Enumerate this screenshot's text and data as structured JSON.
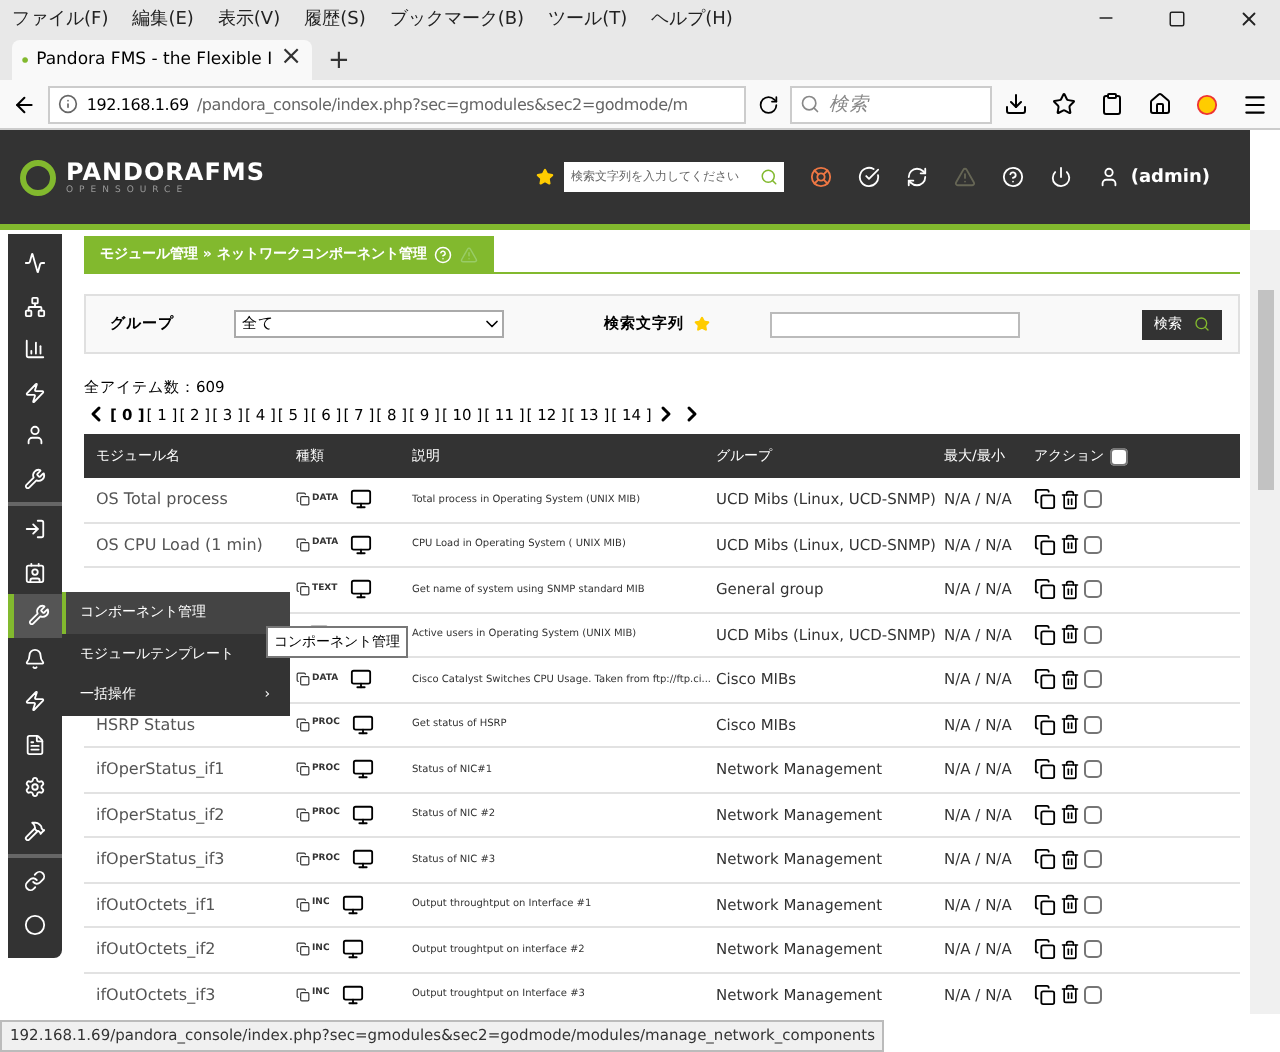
{
  "menubar": [
    "ファイル(F)",
    "編集(E)",
    "表示(V)",
    "履歴(S)",
    "ブックマーク(B)",
    "ツール(T)",
    "ヘルプ(H)"
  ],
  "tab": {
    "title": "Pandora FMS - the Flexible I",
    "close": "×",
    "new": "+"
  },
  "address": {
    "host": "192.168.1.69",
    "path": "/pandora_console/index.php?sec=gmodules&sec2=godmode/m",
    "search_placeholder": "検索"
  },
  "header": {
    "logo": "PANDORAFMS",
    "logo_sub": "OPENSOURCE",
    "search_placeholder": "検索文字列を入力してください",
    "user": "(admin)"
  },
  "breadcrumb": "モジュール管理 » ネットワークコンポーネント管理",
  "filter": {
    "group_label": "グループ",
    "group_value": "全て",
    "search_label": "検索文字列",
    "button": "検索"
  },
  "total": "全アイテム数：609",
  "pages": [
    {
      "label": "[ 0 ]",
      "selected": true
    },
    {
      "label": "[ 1 ]",
      "selected": false
    },
    {
      "label": "[ 2 ]",
      "selected": false
    },
    {
      "label": "[ 3 ]",
      "selected": false
    },
    {
      "label": "[ 4 ]",
      "selected": false
    },
    {
      "label": "[ 5 ]",
      "selected": false
    },
    {
      "label": "[ 6 ]",
      "selected": false
    },
    {
      "label": "[ 7 ]",
      "selected": false
    },
    {
      "label": "[ 8 ]",
      "selected": false
    },
    {
      "label": "[ 9 ]",
      "selected": false
    },
    {
      "label": "[ 10 ]",
      "selected": false
    },
    {
      "label": "[ 11 ]",
      "selected": false
    },
    {
      "label": "[ 12 ]",
      "selected": false
    },
    {
      "label": "[ 13 ]",
      "selected": false
    },
    {
      "label": "[ 14 ]",
      "selected": false
    }
  ],
  "columns": [
    "モジュール名",
    "種類",
    "説明",
    "グループ",
    "最大/最小",
    "アクション"
  ],
  "select_all_checked": false,
  "rows": [
    {
      "name": "OS Total process",
      "type": "DATA",
      "description": "Total process in Operating System (UNIX MIB)",
      "group": "UCD Mibs (Linux, UCD-SNMP)",
      "range": "N/A / N/A",
      "checked": false
    },
    {
      "name": "OS CPU Load (1 min)",
      "type": "DATA",
      "description": "CPU Load in Operating System ( UNIX MIB)",
      "group": "UCD Mibs (Linux, UCD-SNMP)",
      "range": "N/A / N/A",
      "checked": false
    },
    {
      "type": "TEXT",
      "description": "Get name of system using SNMP standard MIB",
      "group": "General group",
      "range": "N/A / N/A",
      "checked": false
    },
    {
      "description": "Active users in Operating System (UNIX MIB)",
      "group": "UCD Mibs (Linux, UCD-SNMP)",
      "range": "N/A / N/A",
      "checked": false
    },
    {
      "type": "DATA",
      "description": "Cisco Catalyst Switches CPU Usage. Taken from ftp://ftp.ci...",
      "group": "Cisco MIBs",
      "range": "N/A / N/A",
      "checked": false
    },
    {
      "name": "HSRP Status",
      "type": "PROC",
      "description": "Get status of HSRP",
      "group": "Cisco MIBs",
      "range": "N/A / N/A",
      "checked": false
    },
    {
      "name": "ifOperStatus_if1",
      "type": "PROC",
      "description": "Status of NIC#1",
      "group": "Network Management",
      "range": "N/A / N/A",
      "checked": false
    },
    {
      "name": "ifOperStatus_if2",
      "type": "PROC",
      "description": "Status of NIC #2",
      "group": "Network Management",
      "range": "N/A / N/A",
      "checked": false
    },
    {
      "name": "ifOperStatus_if3",
      "type": "PROC",
      "description": "Status of NIC #3",
      "group": "Network Management",
      "range": "N/A / N/A",
      "checked": false
    },
    {
      "name": "ifOutOctets_if1",
      "type": "INC",
      "description": "Output throughtput on Interface #1",
      "group": "Network Management",
      "range": "N/A / N/A",
      "checked": false
    },
    {
      "name": "ifOutOctets_if2",
      "type": "INC",
      "description": "Output troughtput on interface #2",
      "group": "Network Management",
      "range": "N/A / N/A",
      "checked": false
    },
    {
      "name": "ifOutOctets_if3",
      "type": "INC",
      "description": "Output troughtput on Interface #3",
      "group": "Network Management",
      "range": "N/A / N/A",
      "checked": false
    }
  ],
  "flyout": [
    {
      "label": "コンポーネント管理",
      "selected": true
    },
    {
      "label": "モジュールテンプレート",
      "selected": false
    },
    {
      "label": "一括操作",
      "selected": false,
      "arrow": "›"
    }
  ],
  "tooltip": "コンポーネント管理",
  "status_url": "192.168.1.69/pandora_console/index.php?sec=gmodules&sec2=godmode/modules/manage_network_components"
}
